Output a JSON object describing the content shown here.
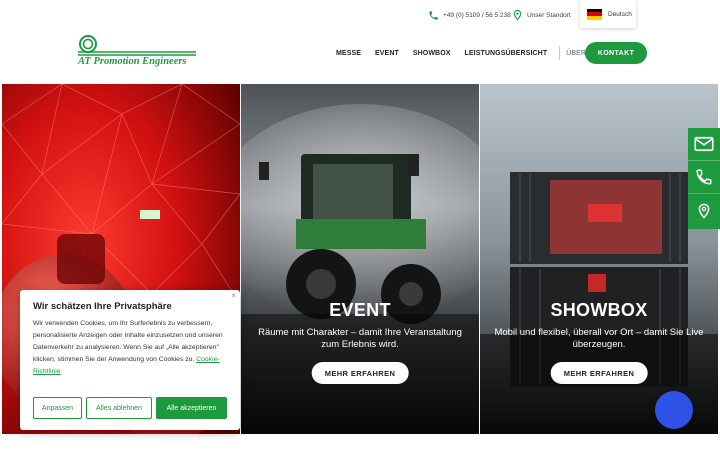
{
  "topbar": {
    "phone": "+49 (0) 5109 / 56 5 238",
    "location": "Unser Standort",
    "language": "Deutsch",
    "flag_colors": [
      "#000000",
      "#dd0000",
      "#ffce00"
    ]
  },
  "header": {
    "logo_text": "AT Promotion Engineers",
    "nav": [
      "MESSE",
      "EVENT",
      "SHOWBOX",
      "LEISTUNGSÜBERSICHT"
    ],
    "nav_secondary": "ÜBER UNS",
    "cta": "KONTAKT"
  },
  "panels": [
    {
      "title": "",
      "subtitle": "",
      "button": ""
    },
    {
      "title": "EVENT",
      "subtitle": "Räume mit Charakter – damit Ihre Veranstaltung zum Erlebnis wird.",
      "button": "MEHR ERFAHREN"
    },
    {
      "title": "SHOWBOX",
      "subtitle": "Mobil und flexibel, überall vor Ort – damit Sie Live überzeugen.",
      "button": "MEHR ERFAHREN"
    }
  ],
  "sidebar": {
    "icons": [
      "mail-icon",
      "phone-icon",
      "location-pin-icon"
    ]
  },
  "cookie": {
    "close": "×",
    "title": "Wir schätzen Ihre Privatsphäre",
    "text": "Wir verwenden Cookies, um Ihr Surferlebnis zu verbessern, personalisierte Anzeigen oder Inhalte einzusetzen und unseren Datenverkehr zu analysieren. Wenn Sie auf „Alle akzeptieren\" klicken, stimmen Sie der Anwendung von Cookies zu.",
    "link": "Cookie-Richtlinie",
    "buttons": {
      "customize": "Anpassen",
      "reject": "Alles ablehnen",
      "accept": "Alle akzeptieren"
    }
  },
  "chat": {
    "mark": ""
  },
  "colors": {
    "brand_green": "#1e9a3e",
    "chat_blue": "#2f52e6"
  }
}
